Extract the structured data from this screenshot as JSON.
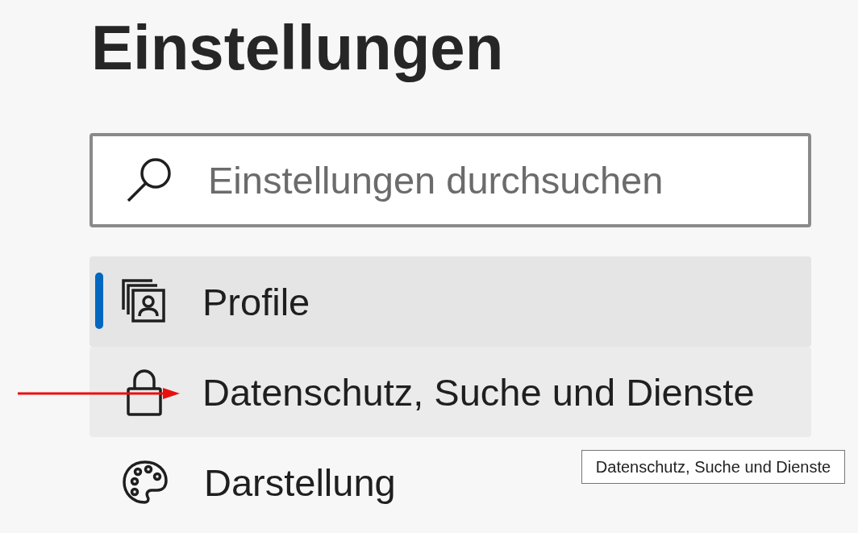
{
  "title": "Einstellungen",
  "search": {
    "placeholder": "Einstellungen durchsuchen"
  },
  "nav_items": [
    {
      "kind": "profile",
      "label": "Profile",
      "selected": true,
      "hovered": false
    },
    {
      "kind": "lock",
      "label": "Datenschutz, Suche und Dienste",
      "selected": false,
      "hovered": true
    },
    {
      "kind": "palette",
      "label": "Darstellung",
      "selected": false,
      "hovered": false
    }
  ],
  "tooltip": {
    "text": "Datenschutz, Suche und Dienste"
  }
}
